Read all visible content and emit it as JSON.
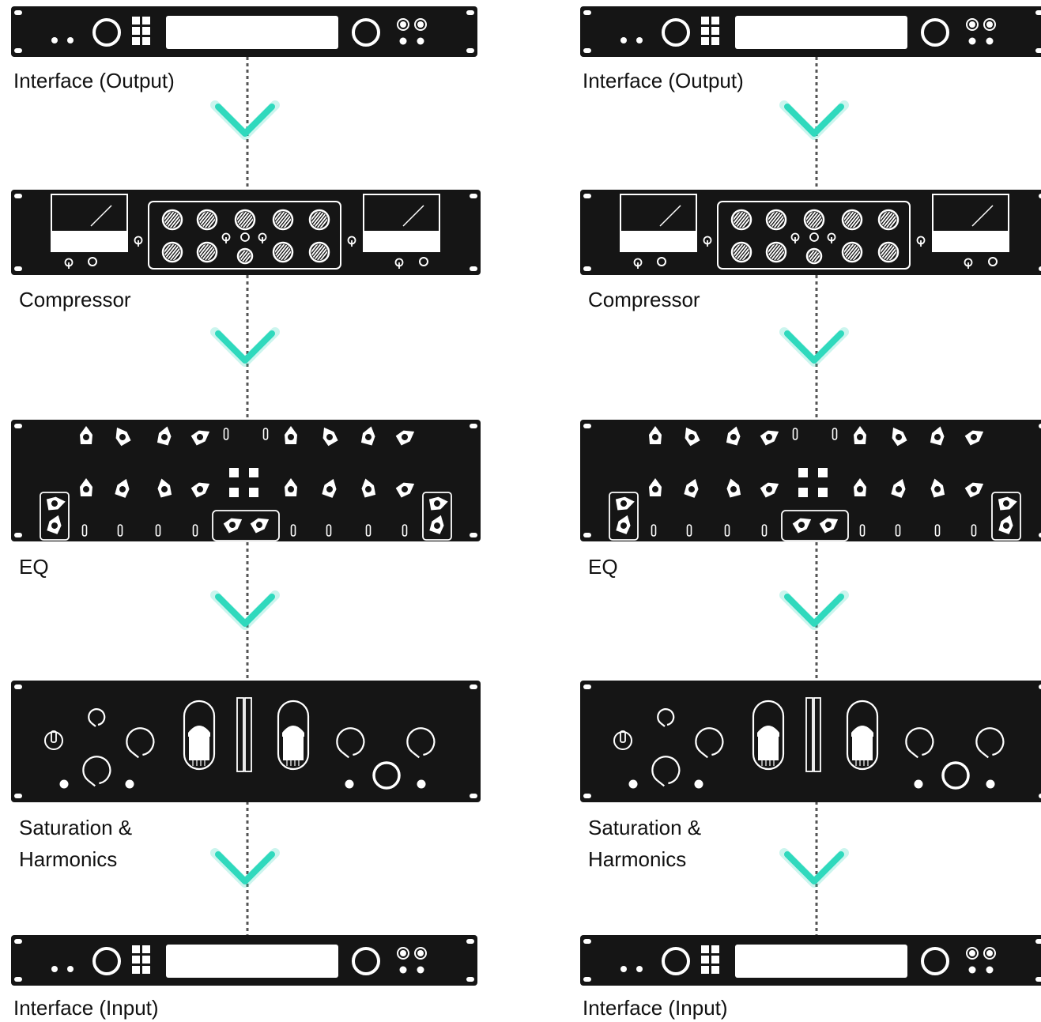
{
  "accent_color": "#2fd9bd",
  "panel_color": "#151515",
  "columns": [
    {
      "stages": [
        {
          "kind": "interface",
          "label": "Interface (Output)"
        },
        {
          "kind": "compressor",
          "label": "Compressor"
        },
        {
          "kind": "eq",
          "label": "EQ"
        },
        {
          "kind": "saturation",
          "label_lines": [
            "Saturation &",
            "Harmonics"
          ]
        },
        {
          "kind": "interface",
          "label": "Interface (Input)"
        }
      ]
    },
    {
      "stages": [
        {
          "kind": "interface",
          "label": "Interface (Output)"
        },
        {
          "kind": "compressor",
          "label": "Compressor"
        },
        {
          "kind": "eq",
          "label": "EQ"
        },
        {
          "kind": "saturation",
          "label_lines": [
            "Saturation &",
            "Harmonics"
          ]
        },
        {
          "kind": "interface",
          "label": "Interface (Input)"
        }
      ]
    }
  ]
}
